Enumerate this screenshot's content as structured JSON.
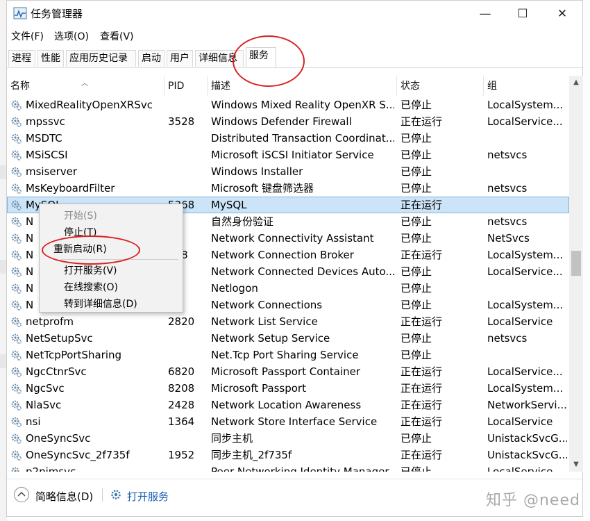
{
  "window": {
    "title": "任务管理器",
    "minimize": "—",
    "maximize": "☐",
    "close": "✕"
  },
  "menu": [
    "文件(F)",
    "选项(O)",
    "查看(V)"
  ],
  "tabs": [
    "进程",
    "性能",
    "应用历史记录",
    "启动",
    "用户",
    "详细信息",
    "服务"
  ],
  "columns": [
    "名称",
    "PID",
    "描述",
    "状态",
    "组"
  ],
  "rows": [
    {
      "name": "MixedRealityOpenXRSvc",
      "pid": "",
      "desc": "Windows Mixed Reality OpenXR S...",
      "status": "已停止",
      "group": "LocalSystem..."
    },
    {
      "name": "mpssvc",
      "pid": "3528",
      "desc": "Windows Defender Firewall",
      "status": "正在运行",
      "group": "LocalService..."
    },
    {
      "name": "MSDTC",
      "pid": "",
      "desc": "Distributed Transaction Coordinat...",
      "status": "已停止",
      "group": ""
    },
    {
      "name": "MSiSCSI",
      "pid": "",
      "desc": "Microsoft iSCSI Initiator Service",
      "status": "已停止",
      "group": "netsvcs"
    },
    {
      "name": "msiserver",
      "pid": "",
      "desc": "Windows Installer",
      "status": "已停止",
      "group": ""
    },
    {
      "name": "MsKeyboardFilter",
      "pid": "",
      "desc": "Microsoft 键盘筛选器",
      "status": "已停止",
      "group": "netsvcs"
    },
    {
      "name": "MySQL",
      "pid": "5368",
      "desc": "MySQL",
      "status": "正在运行",
      "group": ""
    },
    {
      "name": "N",
      "pid": "",
      "desc": "自然身份验证",
      "status": "已停止",
      "group": "netsvcs"
    },
    {
      "name": "N",
      "pid": "",
      "desc": "Network Connectivity Assistant",
      "status": "已停止",
      "group": "NetSvcs"
    },
    {
      "name": "N",
      "pid": "508",
      "desc": "Network Connection Broker",
      "status": "正在运行",
      "group": "LocalSystem..."
    },
    {
      "name": "N",
      "pid": "",
      "desc": "Network Connected Devices Auto...",
      "status": "已停止",
      "group": "LocalService..."
    },
    {
      "name": "N",
      "pid": "",
      "desc": "Netlogon",
      "status": "已停止",
      "group": ""
    },
    {
      "name": "N",
      "pid": "",
      "desc": "Network Connections",
      "status": "已停止",
      "group": "LocalSystem..."
    },
    {
      "name": "netprofm",
      "pid": "2820",
      "desc": "Network List Service",
      "status": "正在运行",
      "group": "LocalService"
    },
    {
      "name": "NetSetupSvc",
      "pid": "",
      "desc": "Network Setup Service",
      "status": "已停止",
      "group": "netsvcs"
    },
    {
      "name": "NetTcpPortSharing",
      "pid": "",
      "desc": "Net.Tcp Port Sharing Service",
      "status": "已停止",
      "group": ""
    },
    {
      "name": "NgcCtnrSvc",
      "pid": "6820",
      "desc": "Microsoft Passport Container",
      "status": "正在运行",
      "group": "LocalService..."
    },
    {
      "name": "NgcSvc",
      "pid": "8208",
      "desc": "Microsoft Passport",
      "status": "正在运行",
      "group": "LocalSystem..."
    },
    {
      "name": "NlaSvc",
      "pid": "2428",
      "desc": "Network Location Awareness",
      "status": "正在运行",
      "group": "NetworkServi..."
    },
    {
      "name": "nsi",
      "pid": "1364",
      "desc": "Network Store Interface Service",
      "status": "正在运行",
      "group": "LocalService"
    },
    {
      "name": "OneSyncSvc",
      "pid": "",
      "desc": "同步主机",
      "status": "已停止",
      "group": "UnistackSvcG..."
    },
    {
      "name": "OneSyncSvc_2f735f",
      "pid": "1952",
      "desc": "同步主机_2f735f",
      "status": "正在运行",
      "group": "UnistackSvcG..."
    },
    {
      "name": "p2pimsvc",
      "pid": "",
      "desc": "Peer Networking Identity Manager",
      "status": "已停止",
      "group": "LocalService..."
    }
  ],
  "context_menu": [
    "开始(S)",
    "停止(T)",
    "重新启动(R)",
    "打开服务(V)",
    "在线搜索(O)",
    "转到详细信息(D)"
  ],
  "status": {
    "brief": "简略信息(D)",
    "open_services": "打开服务"
  },
  "watermark": "知乎 @need",
  "colors": {
    "selection": "#cce4f7",
    "annotation": "#d92020"
  }
}
